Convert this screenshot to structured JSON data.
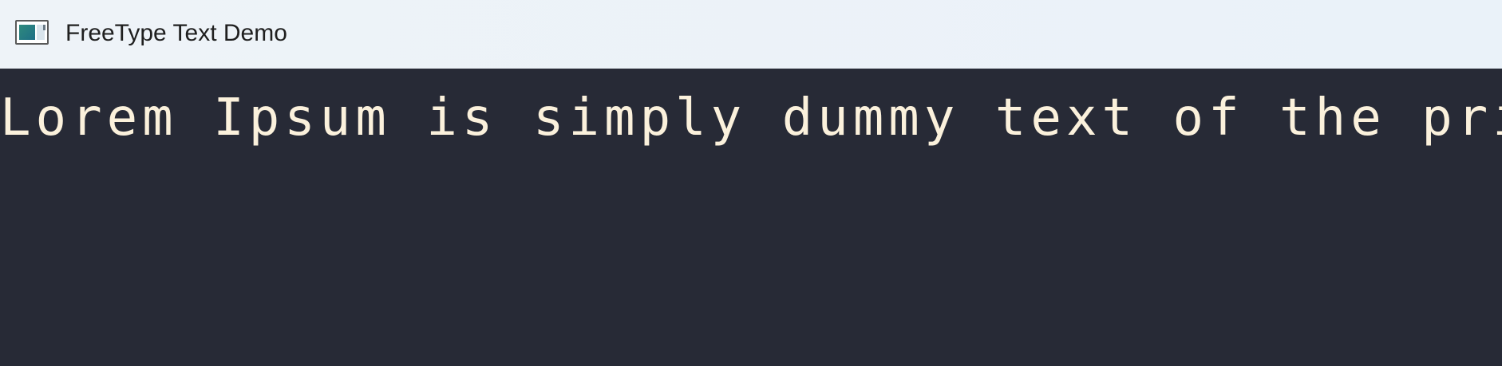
{
  "window": {
    "title": "FreeType Text Demo",
    "app_icon": "window-app-icon"
  },
  "canvas": {
    "text": "Lorem Ipsum is simply dummy text of the print"
  },
  "colors": {
    "titlebar_bg": "#eef3f8",
    "canvas_bg": "#272a36",
    "text": "#fbf1dc"
  }
}
